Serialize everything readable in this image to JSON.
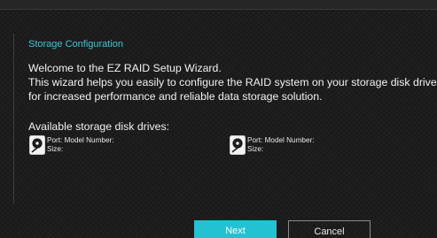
{
  "wizard": {
    "title": "Storage Configuration",
    "intro_line1": "Welcome to the EZ RAID Setup Wizard.",
    "intro_line2": "This wizard helps you easily to configure the RAID system on your storage disk drives",
    "intro_line3": "for increased performance and reliable data storage solution.",
    "available_label": "Available storage disk drives:"
  },
  "drives": [
    {
      "port_label": "Port: Model Number:",
      "size_label": "Size:",
      "icon": "hard-disk-icon"
    },
    {
      "port_label": "Port: Model Number:",
      "size_label": "Size:",
      "icon": "hard-disk-icon"
    }
  ],
  "buttons": {
    "next_label": "Next",
    "cancel_label": "Cancel"
  },
  "colors": {
    "accent": "#23c2d2",
    "title_color": "#3cc7d6",
    "background": "#1c1c1c"
  }
}
